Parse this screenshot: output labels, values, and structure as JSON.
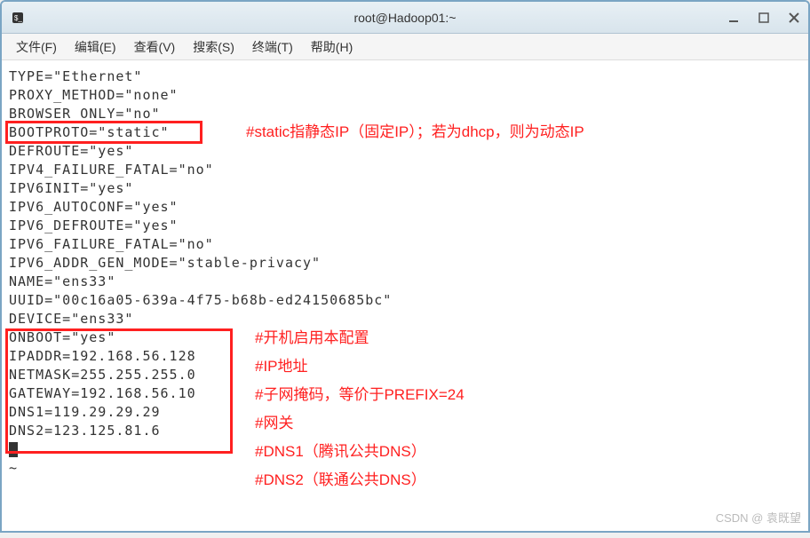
{
  "window": {
    "title": "root@Hadoop01:~"
  },
  "menubar": {
    "file": "文件(F)",
    "edit": "编辑(E)",
    "view": "查看(V)",
    "search": "搜索(S)",
    "terminal": "终端(T)",
    "help": "帮助(H)"
  },
  "terminal_lines": {
    "l0": "TYPE=\"Ethernet\"",
    "l1": "PROXY_METHOD=\"none\"",
    "l2": "BROWSER_ONLY=\"no\"",
    "l3": "BOOTPROTO=\"static\"",
    "l4": "DEFROUTE=\"yes\"",
    "l5": "IPV4_FAILURE_FATAL=\"no\"",
    "l6": "IPV6INIT=\"yes\"",
    "l7": "IPV6_AUTOCONF=\"yes\"",
    "l8": "IPV6_DEFROUTE=\"yes\"",
    "l9": "IPV6_FAILURE_FATAL=\"no\"",
    "l10": "IPV6_ADDR_GEN_MODE=\"stable-privacy\"",
    "l11": "NAME=\"ens33\"",
    "l12": "UUID=\"00c16a05-639a-4f75-b68b-ed24150685bc\"",
    "l13": "DEVICE=\"ens33\"",
    "l14": "ONBOOT=\"yes\"",
    "l15": "IPADDR=192.168.56.128",
    "l16": "NETMASK=255.255.255.0",
    "l17": "GATEWAY=192.168.56.10",
    "l18": "DNS1=119.29.29.29",
    "l19": "DNS2=123.125.81.6",
    "l21": "~"
  },
  "annotations": {
    "a1": "#static指静态IP（固定IP）；若为dhcp，则为动态IP",
    "a2": "#开机启用本配置",
    "a3": "#IP地址",
    "a4": "#子网掩码，等价于PREFIX=24",
    "a5": "#网关",
    "a6": "#DNS1（腾讯公共DNS）",
    "a7": "#DNS2（联通公共DNS）"
  },
  "watermark": "CSDN @ 袁既望"
}
